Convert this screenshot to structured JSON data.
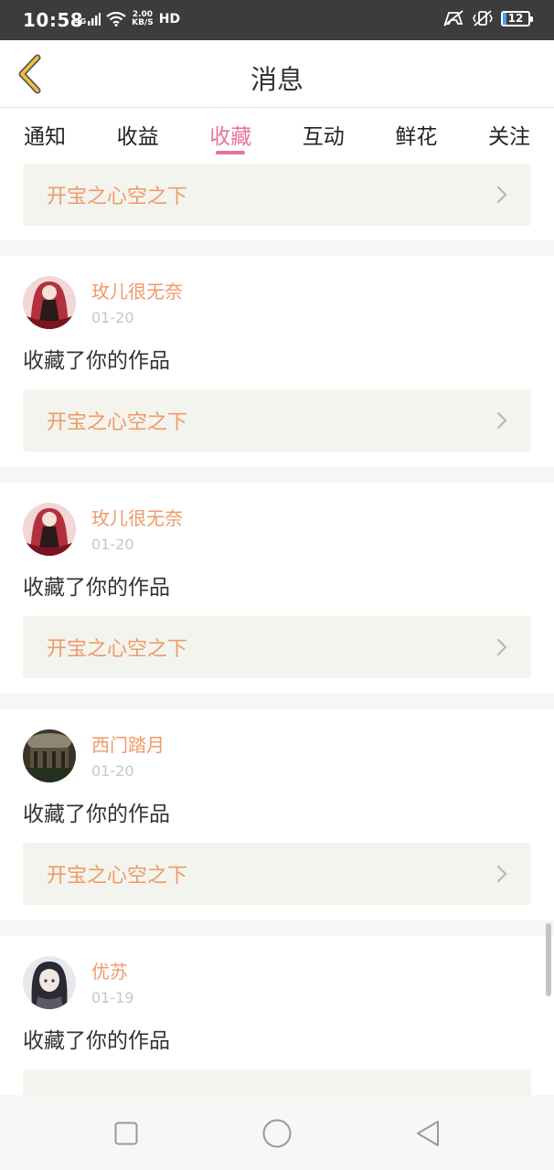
{
  "status_bar": {
    "time": "10:58",
    "network": "4G",
    "speed_value": "2.00",
    "speed_unit": "KB/S",
    "hd": "HD",
    "battery": "12"
  },
  "header": {
    "title": "消息",
    "back_icon": "chevron-left-icon"
  },
  "tabs": [
    {
      "label": "通知",
      "active": false
    },
    {
      "label": "收益",
      "active": false
    },
    {
      "label": "收藏",
      "active": true
    },
    {
      "label": "互动",
      "active": false
    },
    {
      "label": "鲜花",
      "active": false
    },
    {
      "label": "关注",
      "active": false
    }
  ],
  "feed": {
    "top_partial": {
      "work_title": "开宝之心空之下"
    },
    "items": [
      {
        "user": "玫儿很无奈",
        "date": "01-20",
        "action": "收藏了你的作品",
        "work_title": "开宝之心空之下"
      },
      {
        "user": "玫儿很无奈",
        "date": "01-20",
        "action": "收藏了你的作品",
        "work_title": "开宝之心空之下"
      },
      {
        "user": "西门踏月",
        "date": "01-20",
        "action": "收藏了你的作品",
        "work_title": "开宝之心空之下"
      },
      {
        "user": "优苏",
        "date": "01-19",
        "action": "收藏了你的作品",
        "work_title": ""
      }
    ]
  },
  "colors": {
    "accent_pink": "#e8739f",
    "name_orange": "#ef9a68",
    "box_bg": "#f4f4ee",
    "back_yellow": "#f2c13a"
  },
  "nav_bar": {
    "icons": [
      "recent-apps-icon",
      "home-icon",
      "back-icon"
    ]
  }
}
